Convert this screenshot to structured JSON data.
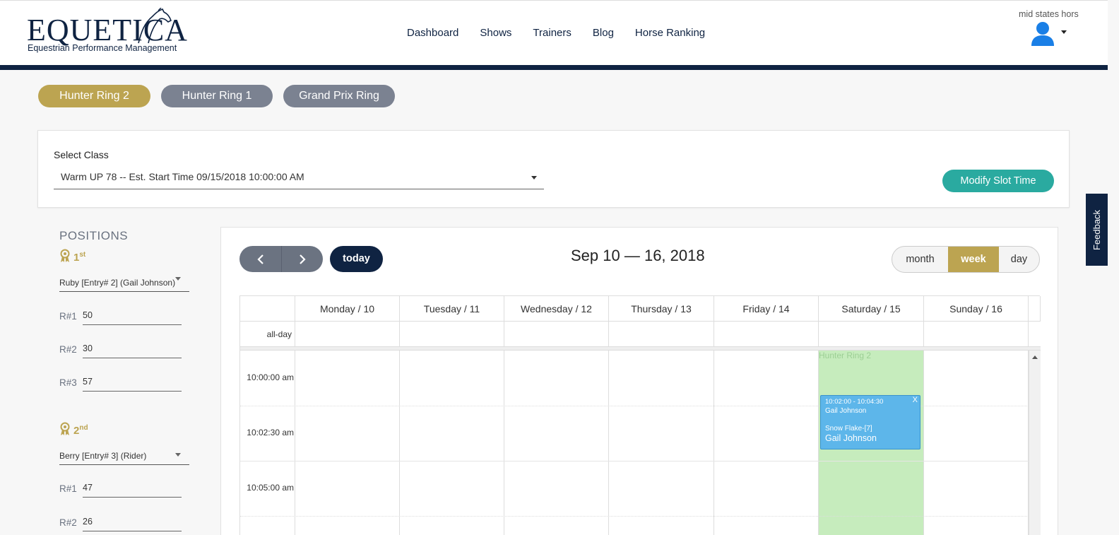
{
  "header": {
    "logo": {
      "word": "EQUETICA",
      "tagline": "Equestrian Performance Management"
    },
    "nav": [
      "Dashboard",
      "Shows",
      "Trainers",
      "Blog",
      "Horse Ranking"
    ],
    "user_name": "mid states hors"
  },
  "rings": [
    {
      "label": "Hunter Ring 2",
      "active": true
    },
    {
      "label": "Hunter Ring 1",
      "active": false
    },
    {
      "label": "Grand Prix Ring",
      "active": false
    }
  ],
  "class_select": {
    "label": "Select Class",
    "value": "Warm UP 78 -- Est. Start Time 09/15/2018 10:00:00 AM",
    "modify_label": "Modify Slot Time"
  },
  "feedback_label": "Feedback",
  "positions": {
    "title": "POSITIONS",
    "places": [
      {
        "number": "1",
        "suffix": "st",
        "horse": "Ruby [Entry# 2] (Gail Johnson)",
        "rounds": [
          {
            "label": "R#1",
            "value": "50"
          },
          {
            "label": "R#2",
            "value": "30"
          },
          {
            "label": "R#3",
            "value": "57"
          }
        ]
      },
      {
        "number": "2",
        "suffix": "nd",
        "horse": "Berry [Entry# 3] (Rider)",
        "rounds": [
          {
            "label": "R#1",
            "value": "47"
          },
          {
            "label": "R#2",
            "value": "26"
          }
        ]
      }
    ]
  },
  "calendar": {
    "title": "Sep 10 — 16, 2018",
    "today_label": "today",
    "views": [
      {
        "label": "month",
        "active": false
      },
      {
        "label": "week",
        "active": true
      },
      {
        "label": "day",
        "active": false
      }
    ],
    "days": [
      "Monday / 10",
      "Tuesday / 11",
      "Wednesday / 12",
      "Thursday / 13",
      "Friday / 14",
      "Saturday / 15",
      "Sunday / 16"
    ],
    "allday_label": "all-day",
    "times": [
      "10:00:00 am",
      "10:02:30 am",
      "10:05:00 am"
    ],
    "ring_label": "Hunter Ring 2",
    "event": {
      "close": "X",
      "time": "10:02:00 - 10:04:30",
      "trainer": "Gail Johnson",
      "horse": "Snow Flake-[7]",
      "rider": "Gail Johnson"
    }
  },
  "colors": {
    "brand_navy": "#0f2342",
    "gold": "#bca451",
    "slate": "#7b8291",
    "teal": "#2aaaa0",
    "event_blue": "#5db6ea",
    "ring_green": "#c6ecbd"
  }
}
